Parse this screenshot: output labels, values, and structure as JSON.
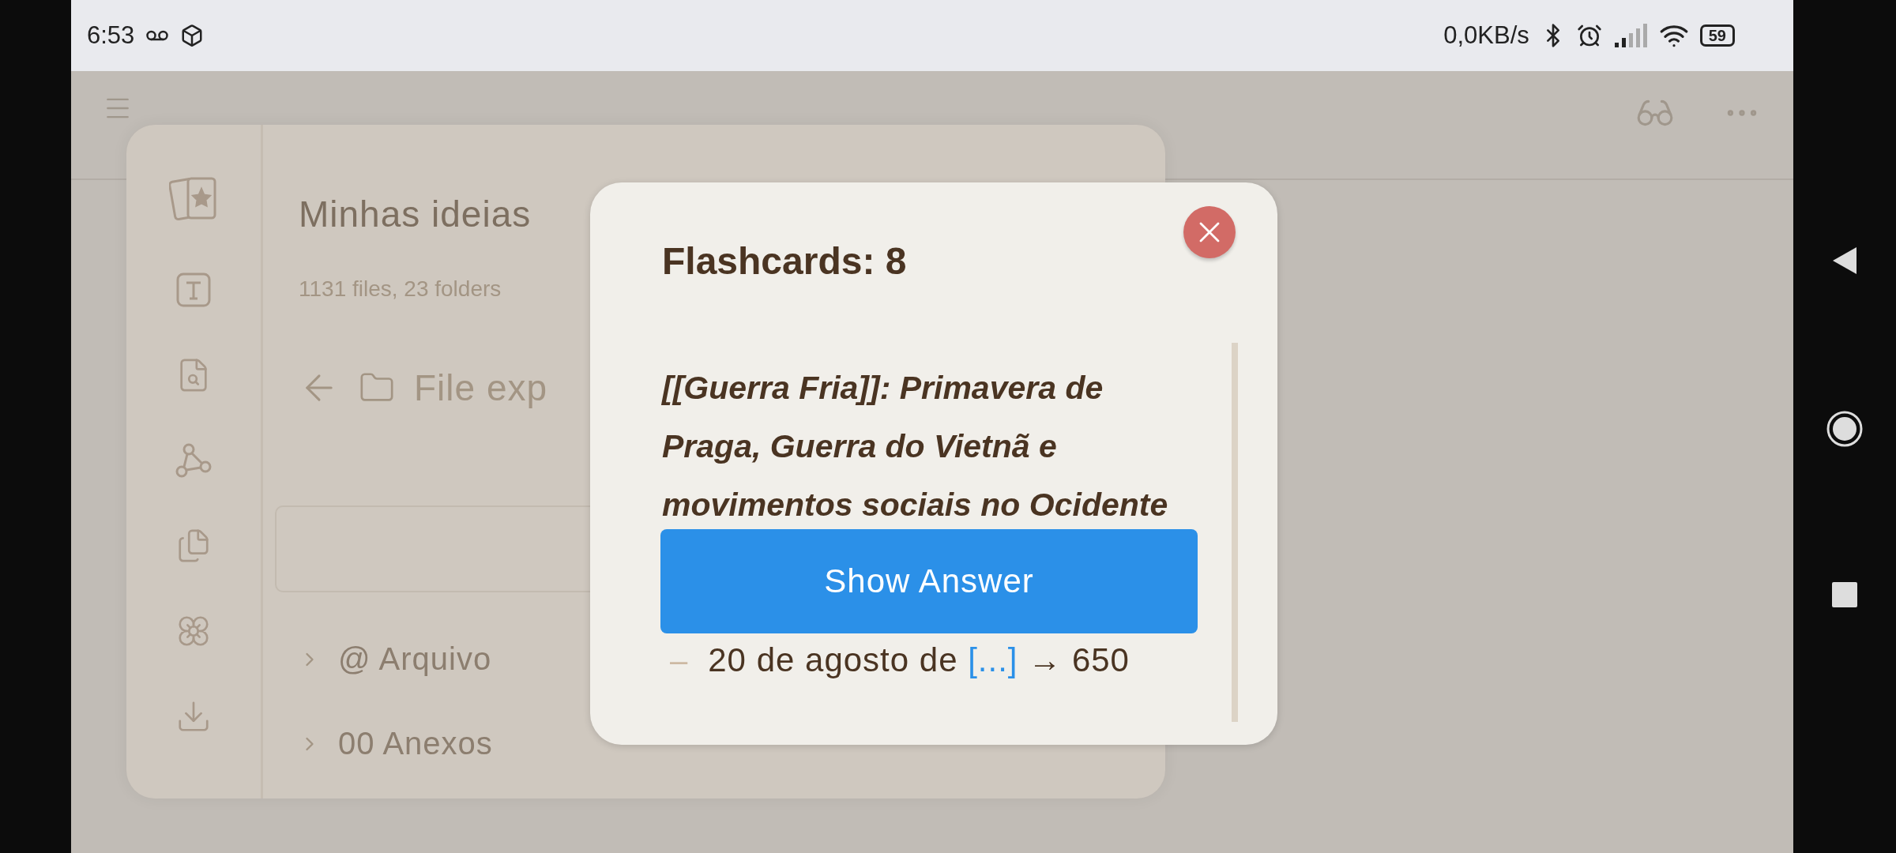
{
  "status_bar": {
    "time": "6:53",
    "network_speed": "0,0KB/s",
    "battery": "59"
  },
  "sidebar": {
    "vault_title": "Minhas ideias",
    "stats": "1131 files, 23 folders",
    "view_title": "File exp",
    "items": [
      {
        "label": "@ Arquivo",
        "expanded": false
      },
      {
        "label": "00 Anexos",
        "expanded": false
      }
    ]
  },
  "modal": {
    "title": "Flashcards: 8",
    "question": "[[Guerra Fria]]: Primavera de Praga, Guerra do Vietnã e movimentos sociais no Ocidente",
    "button": "Show Answer",
    "context_line": {
      "bullet": "–",
      "before": "20 de agosto de ",
      "link": "[...]",
      "after": " → 650"
    }
  }
}
